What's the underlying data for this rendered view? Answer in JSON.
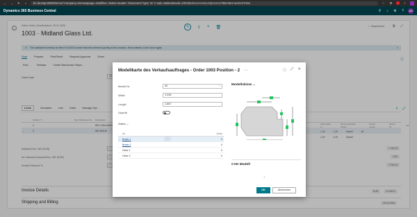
{
  "browser": {
    "address": "bc-devtop:8080/Demo/?company=Demo&page=42&filter='Sales Header'.'Document Type' IS '1' &dc=0&bookmark=23%3bJAAAAAACLAQAAAAJ7BEAMAAaADAtTA0a"
  },
  "app": {
    "name": "Dynamics 365 Business Central",
    "avatar": "JM"
  },
  "record": {
    "breadcrumb": "Sales Order | Arbeitsdatum: 25.01.2026",
    "title": "1003 · Midland Glass Ltd.",
    "saved_label": "✓ Gespeichert"
  },
  "notification": {
    "text": "The available inventory for item H-01000 is lower than the entered quantity at this location.   Show details | Don't show again"
  },
  "actions": [
    "Start",
    "Prepare",
    "Print/Send",
    "Request Approval",
    "Order"
  ],
  "actions2": [
    "Post...",
    "Release",
    "Create Warehouse Shipm..."
  ],
  "order_date": {
    "label": "Order Date",
    "value": "25.01.2026"
  },
  "lines": {
    "tabs": [
      "Lines",
      "Verwalten",
      "Line",
      "Order",
      "Manage Opt..."
    ],
    "headers": [
      "",
      "Position T...",
      "Item Reference No.",
      "Description"
    ],
    "rows": [
      {
        "marker": "",
        "pos": "1",
        "ref": "",
        "desc": "ISO 2-Sch (ESG/Float)"
      },
      {
        "marker": "→",
        "pos": "2",
        "ref": "",
        "desc": "ISO SOLIX"
      }
    ],
    "right_headers": [
      "Zeilenrabatt %",
      "Rechnungsrabatt (Netto)",
      "Bestell-menge",
      "Modell Nr.",
      "Stk."
    ],
    "right_rows": [
      {
        "a": "1,25",
        "b": "1,25",
        "c": "Modell",
        "d": "45"
      },
      {
        "a": "2,49",
        "b": "2,49",
        "c": "Modell",
        "d": ""
      }
    ]
  },
  "totals": {
    "subtotal_label": "Subtotal Excl. VAT (EUR)",
    "discount_label": "Inv. Discount Amount Excl. VAT (EUR)",
    "discount_pct_label": "Invoice Discount %",
    "r1": "7.742,24",
    "r2": "0,00",
    "r3": "7.742,24"
  },
  "sections": {
    "invoice": "Invoice Details",
    "invoice_r1": "EUR",
    "invoice_r2": "10 DAYS",
    "shipping": "Shipping and Billing",
    "shipping_r": "25.01.2026"
  },
  "modal": {
    "title": "Modellkarte des Verkaufsauftrages - Order 1003 Position",
    "position": "2",
    "fields": [
      {
        "label": "Modell Nr.",
        "value": "42"
      },
      {
        "label": "Width",
        "value": "1.245"
      },
      {
        "label": "Length",
        "value": "1.867"
      },
      {
        "label": "Geprüft",
        "value": ""
      }
    ],
    "zeilen_label": "Zeilen",
    "table_headers": {
      "art": "Art",
      "breite": "Breite"
    },
    "table_rows": [
      {
        "art": "Breite 1",
        "breite": "0"
      },
      {
        "art": "Breite 2",
        "breite": "0"
      },
      {
        "art": "Höhe 1",
        "breite": "0"
      },
      {
        "art": "Höhe 2",
        "breite": "0"
      }
    ],
    "sketch_title": "Modellskizze",
    "cad_title": "CAD Modell",
    "ok_label": "OK",
    "cancel_label": "Abbrechen"
  },
  "colors": {
    "appbar": "#00343d",
    "accent": "#00829b",
    "ok_button": "#007a8a",
    "sketch_fill": "#d6d6d6",
    "marker_green": "#22c55e"
  }
}
